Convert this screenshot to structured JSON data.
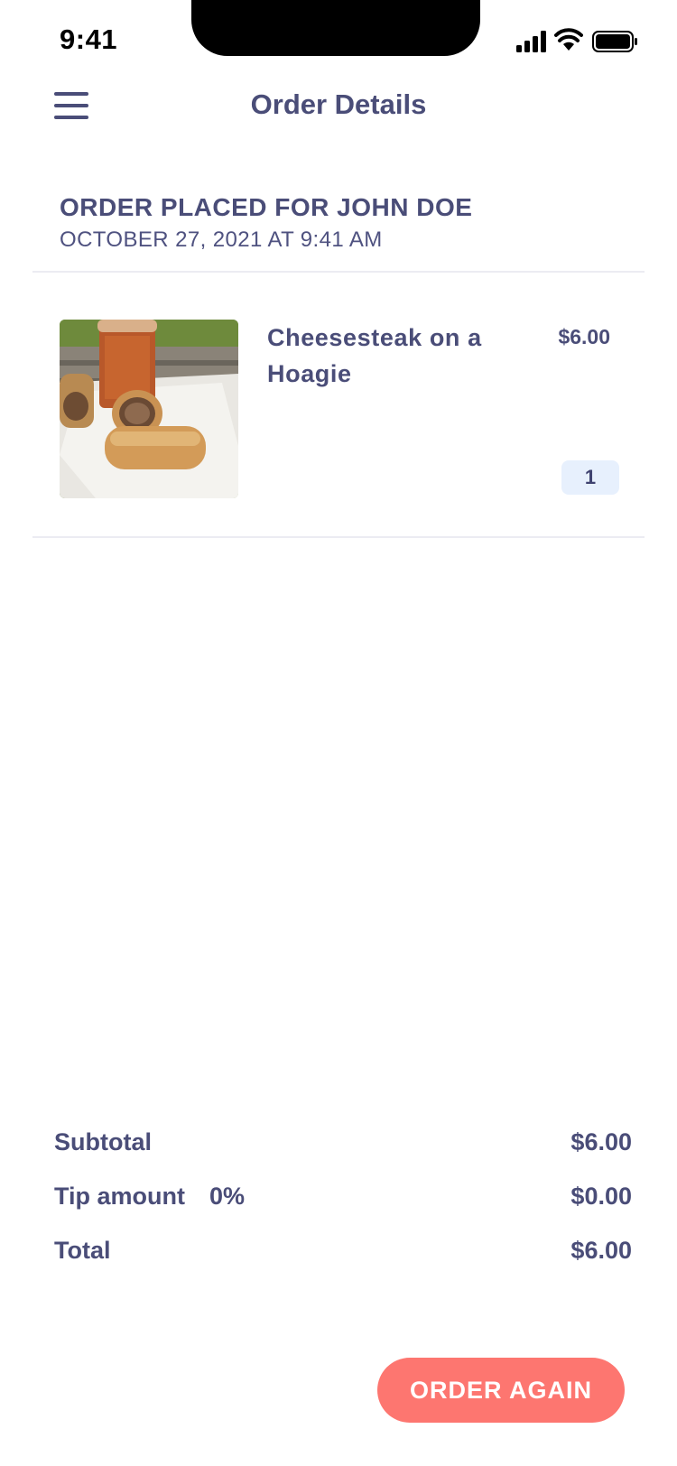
{
  "status_bar": {
    "time": "9:41"
  },
  "header": {
    "title": "Order Details",
    "menu_icon": "hamburger-menu-icon"
  },
  "order": {
    "heading": "ORDER PLACED FOR JOHN DOE",
    "date": "OCTOBER 27, 2021 AT 9:41 AM",
    "items": [
      {
        "name": "Cheesesteak on a Hoagie",
        "price": "$6.00",
        "quantity": "1"
      }
    ]
  },
  "totals": {
    "subtotal_label": "Subtotal",
    "subtotal_value": "$6.00",
    "tip_label": "Tip amount",
    "tip_percent": "0%",
    "tip_value": "$0.00",
    "total_label": "Total",
    "total_value": "$6.00"
  },
  "actions": {
    "order_again_label": "ORDER AGAIN"
  },
  "colors": {
    "text": "#4a4d78",
    "accent": "#fd7670",
    "badge_bg": "#e7f0fd"
  }
}
